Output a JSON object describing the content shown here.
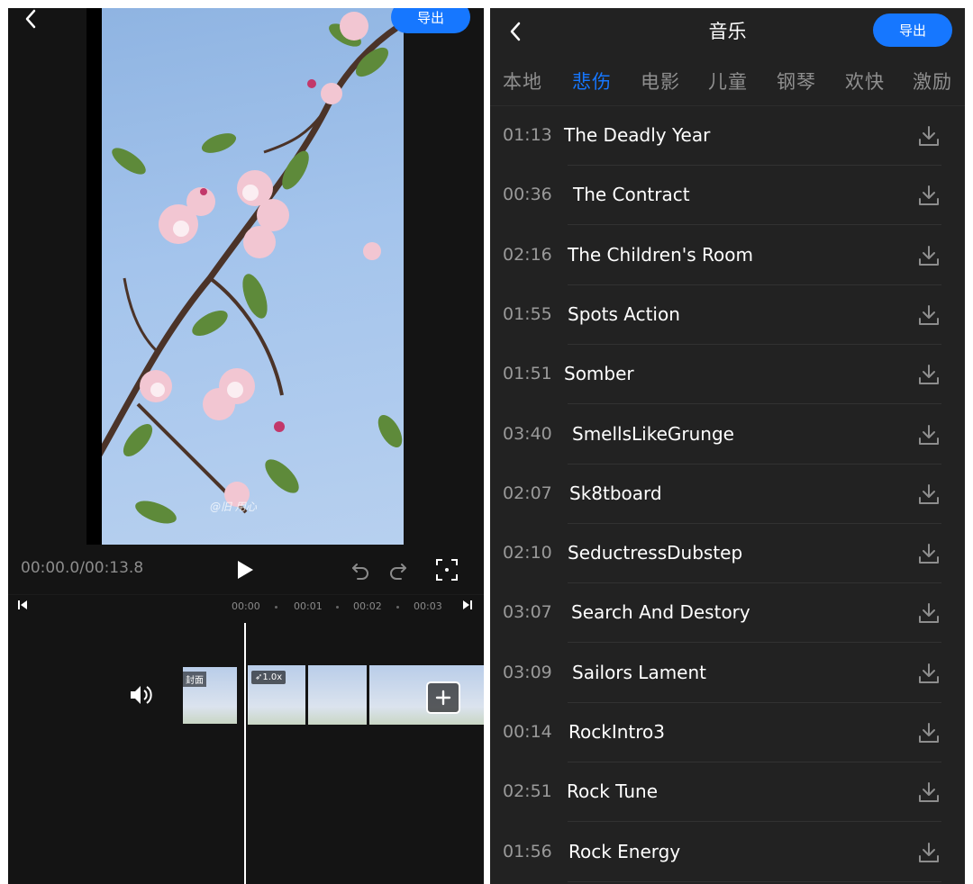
{
  "left_panel": {
    "export_label": "导出",
    "timecode": "00:00.0/00:13.8",
    "photo_watermark": "@旧 用心",
    "ruler_labels": [
      "00:00",
      "00:01",
      "00:02",
      "00:03"
    ],
    "cover_label": "封面",
    "speed_label": "1.0x"
  },
  "right_panel": {
    "title": "音乐",
    "export_label": "导出",
    "tabs": [
      {
        "label": "本地",
        "active": false
      },
      {
        "label": "悲伤",
        "active": true
      },
      {
        "label": "电影",
        "active": false
      },
      {
        "label": "儿童",
        "active": false
      },
      {
        "label": "钢琴",
        "active": false
      },
      {
        "label": "欢快",
        "active": false
      },
      {
        "label": "激励",
        "active": false
      }
    ],
    "songs": [
      {
        "duration": "01:13",
        "title": "The Deadly Year"
      },
      {
        "duration": "00:36",
        "title": "The Contract"
      },
      {
        "duration": "02:16",
        "title": "The Children's Room"
      },
      {
        "duration": "01:55",
        "title": "Spots Action"
      },
      {
        "duration": "01:51",
        "title": "Somber"
      },
      {
        "duration": "03:40",
        "title": "SmellsLikeGrunge"
      },
      {
        "duration": "02:07",
        "title": "Sk8tboard"
      },
      {
        "duration": "02:10",
        "title": "SeductressDubstep"
      },
      {
        "duration": "03:07",
        "title": "Search And Destory"
      },
      {
        "duration": "03:09",
        "title": "Sailors Lament"
      },
      {
        "duration": "00:14",
        "title": "RockIntro3"
      },
      {
        "duration": "02:51",
        "title": "Rock Tune"
      },
      {
        "duration": "01:56",
        "title": "Rock Energy"
      }
    ]
  },
  "colors": {
    "accent": "#1677ff",
    "panel_dark": "#141414",
    "list_bg": "#222222"
  },
  "icons": [
    "back-icon",
    "play-icon",
    "undo-icon",
    "redo-icon",
    "fullscreen-icon",
    "skip-start-icon",
    "skip-end-icon",
    "volume-icon",
    "add-icon",
    "rocket-icon",
    "download-icon"
  ]
}
